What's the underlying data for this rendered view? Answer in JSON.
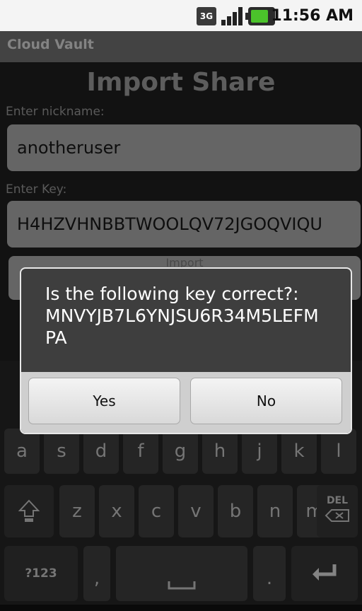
{
  "status_bar": {
    "network": "3G",
    "time": "11:56 AM"
  },
  "app": {
    "title": "Cloud Vault",
    "heading": "Import Share"
  },
  "form": {
    "nickname_label": "Enter nickname:",
    "nickname_value": "anotheruser",
    "key_label": "Enter Key:",
    "key_value": "H4HZVHNBBTWOOLQV72JGOQVIQU",
    "import_button": "Import"
  },
  "dialog": {
    "message": "Is the following key correct?:\nMNVYJB7L6YNJSU6R34M5LEFM\nPA",
    "yes": "Yes",
    "no": "No"
  },
  "keyboard": {
    "row2": [
      "a",
      "s",
      "d",
      "f",
      "g",
      "h",
      "j",
      "k",
      "l"
    ],
    "row3": [
      "z",
      "x",
      "c",
      "v",
      "b",
      "n",
      "m"
    ],
    "del_label": "DEL",
    "sym_label": "?123",
    "comma": ",",
    "period": "."
  }
}
